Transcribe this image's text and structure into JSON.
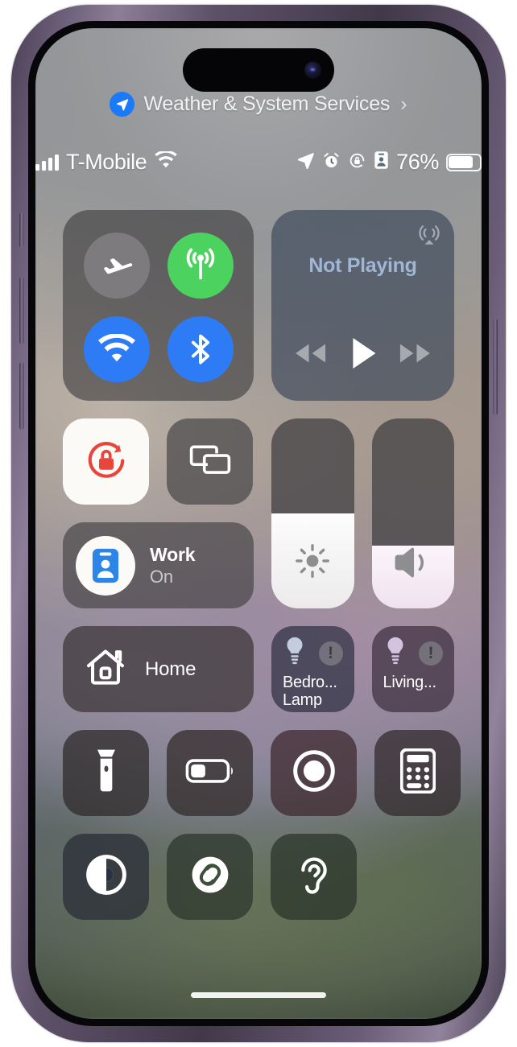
{
  "device": {
    "name": "iphone-14-pro",
    "frame_color": "#6d5f79",
    "buttons": [
      "mute-switch",
      "volume-up",
      "volume-down",
      "power"
    ]
  },
  "location_banner": {
    "icon": "location-arrow-icon",
    "label": "Weather & System Services",
    "chevron": "›",
    "accent": "#1a7af8"
  },
  "status_bar": {
    "signal_icon": "cellular-signal-icon",
    "carrier": "T-Mobile",
    "wifi_icon": "wifi-icon",
    "location_icon": "location-arrow-icon",
    "alarm_icon": "alarm-clock-icon",
    "rotation_lock_icon": "rotation-lock-icon",
    "focus_icon": "work-focus-badge-icon",
    "battery_percent": "76%",
    "battery_icon": "battery-icon"
  },
  "control_center": {
    "connectivity": {
      "airplane": {
        "label": "Airplane Mode",
        "state": "off",
        "color": "#7d7b7d",
        "icon": "airplane-icon"
      },
      "cellular": {
        "label": "Cellular Data",
        "state": "on",
        "color": "#4cd35f",
        "icon": "cellular-antenna-icon"
      },
      "wifi": {
        "label": "Wi-Fi",
        "state": "on",
        "color": "#2d7cf6",
        "icon": "wifi-icon"
      },
      "bluetooth": {
        "label": "Bluetooth",
        "state": "on",
        "color": "#2d7cf6",
        "icon": "bluetooth-icon"
      }
    },
    "media": {
      "title": "Not Playing",
      "airplay_icon": "airplay-audio-icon",
      "previous_icon": "rewind-icon",
      "play_icon": "play-icon",
      "next_icon": "fast-forward-icon",
      "title_color": "#9fb6d6"
    },
    "rotation_lock": {
      "label": "Rotation Lock",
      "state": "on",
      "icon": "rotation-lock-icon",
      "accent": "#e8453c"
    },
    "screen_mirroring": {
      "label": "Screen Mirroring",
      "state": "off",
      "icon": "screen-mirroring-icon"
    },
    "focus": {
      "name": "Work",
      "state": "On",
      "icon": "work-focus-badge-icon",
      "accent": "#2d85e8"
    },
    "brightness": {
      "label": "Brightness",
      "icon": "brightness-sun-icon",
      "value": 50
    },
    "volume": {
      "label": "Volume",
      "icon": "speaker-wave-icon",
      "value": 33
    },
    "home": {
      "label": "Home",
      "icon": "home-house-icon"
    },
    "accessories": [
      {
        "name": "Bedro...\nLamp",
        "icon": "lightbulb-icon",
        "badge": "!",
        "badge_label": "no-response-badge",
        "tint": "#2f3142"
      },
      {
        "name": "Living...",
        "icon": "lightbulb-icon",
        "badge": "!",
        "badge_label": "no-response-badge",
        "tint": "#403242"
      }
    ],
    "utilities_row_1": [
      {
        "label": "Flashlight",
        "icon": "flashlight-icon"
      },
      {
        "label": "Low Power Mode",
        "icon": "battery-low-power-icon"
      },
      {
        "label": "Screen Recording",
        "icon": "screen-record-icon"
      },
      {
        "label": "Calculator",
        "icon": "calculator-icon"
      }
    ],
    "utilities_row_2": [
      {
        "label": "Dark Mode",
        "icon": "dark-mode-icon"
      },
      {
        "label": "Music Recognition",
        "icon": "shazam-icon"
      },
      {
        "label": "Hearing",
        "icon": "ear-hearing-icon"
      }
    ]
  },
  "home_indicator": {
    "label": "Home Indicator"
  }
}
